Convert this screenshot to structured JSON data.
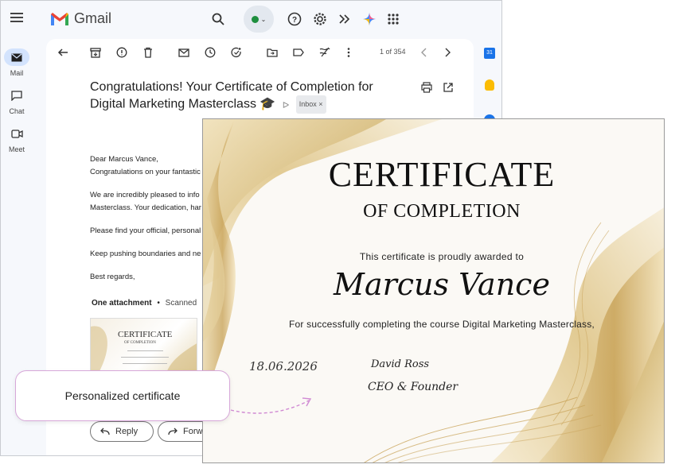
{
  "topbar": {
    "app_title": "Gmail",
    "icons": [
      "menu-icon",
      "search-icon",
      "status-icon",
      "help-icon",
      "settings-icon",
      "addons-icon",
      "gemini-icon",
      "apps-icon"
    ]
  },
  "nav": {
    "items": [
      {
        "label": "Mail",
        "icon": "mail-icon"
      },
      {
        "label": "Chat",
        "icon": "chat-icon"
      },
      {
        "label": "Meet",
        "icon": "meet-icon"
      }
    ]
  },
  "toolbar": {
    "pager": "1 of 354"
  },
  "email": {
    "subject": "Congratulations! Your Certificate of Completion for Digital Marketing Masterclass 🎓",
    "label": "Inbox",
    "label_close": "×",
    "body": [
      "Dear Marcus Vance,",
      "Congratulations on your fantastic",
      "We are incredibly pleased to info",
      "Masterclass. Your dedication, har",
      "Please find your official, personal",
      "Keep pushing boundaries and ne",
      "Best regards,"
    ],
    "attachment_count": "One attachment",
    "attachment_sep": "•",
    "attachment_scan": "Scanned",
    "thumb_title": "CERTIFICATE",
    "thumb_sub": "OF COMPLETION",
    "reply": "Reply",
    "forward": "Forwa"
  },
  "certificate": {
    "title": "CERTIFICATE",
    "subtitle": "OF COMPLETION",
    "awarded": "This certificate is proudly awarded to",
    "name": "Marcus Vance",
    "course": "For successfully completing the course Digital Marketing Masterclass,",
    "date": "18.06.2026",
    "signature": "David Ross",
    "role": "CEO & Founder"
  },
  "callout": {
    "text": "Personalized certificate"
  },
  "colors": {
    "gold": "#c9a860",
    "accent_blue": "#1a73e8",
    "callout_border": "#d7a7d9"
  }
}
